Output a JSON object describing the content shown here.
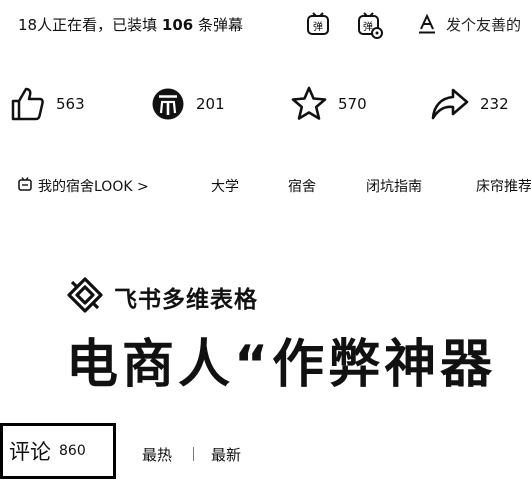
{
  "danmaku_bar": {
    "viewer_count": "18",
    "viewer_text": "人正在看，已装填",
    "danmaku_count": "106",
    "danmaku_unit": "条弹幕",
    "input_placeholder": "发个友善的"
  },
  "actions": {
    "like": "563",
    "coin": "201",
    "favorite": "570",
    "share": "232"
  },
  "tags": [
    "我的宿舍LOOK >",
    "大学",
    "宿舍",
    "闭坑指南",
    "床帘推荐"
  ],
  "cover": {
    "brand": "飞书多维表格",
    "title": "电商人“作弊神器"
  },
  "comments": {
    "label": "评论",
    "count": "860",
    "sort_hot": "最热",
    "sort_new": "最新"
  }
}
